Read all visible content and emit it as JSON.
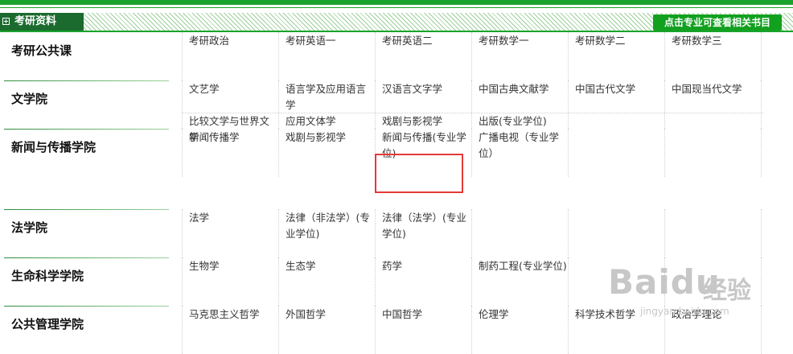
{
  "header": {
    "title": "考研资料",
    "link_label": "点击专业可查看相关书目"
  },
  "categories": [
    {
      "label": "考研公共课",
      "items": [
        "考研政治",
        "考研英语一",
        "考研英语二",
        "考研数学一",
        "考研数学二",
        "考研数学三"
      ]
    },
    {
      "label": "文学院",
      "items": [
        "文艺学",
        "语言学及应用语言学",
        "汉语言文字学",
        "中国古典文献学",
        "中国古代文学",
        "中国现当代文学",
        "比较文学与世界文学",
        "应用文体学",
        "戏剧与影视学",
        "出版(专业学位)"
      ]
    },
    {
      "label": "新闻与传播学院",
      "items": [
        "新闻传播学",
        "戏剧与影视学",
        "新闻与传播(专业学位)",
        "广播电视（专业学位）"
      ]
    },
    {
      "label": "法学院",
      "items": [
        "法学",
        "法律（非法学）(专业学位)",
        "法律（法学）(专业学位)"
      ]
    },
    {
      "label": "生命科学学院",
      "items": [
        "生物学",
        "生态学",
        "药学",
        "制药工程(专业学位)"
      ]
    },
    {
      "label": "公共管理学院",
      "items": [
        "马克思主义哲学",
        "外国哲学",
        "中国哲学",
        "伦理学",
        "科学技术哲学",
        "政治学理论"
      ]
    }
  ],
  "watermark": {
    "logo": "Baidu",
    "product": "经验",
    "url": "jingyan.baidu.com"
  },
  "colors": {
    "brand_green": "#1aa32d",
    "header_dark": "#1b6b2e",
    "highlight": "#e53a3a"
  }
}
